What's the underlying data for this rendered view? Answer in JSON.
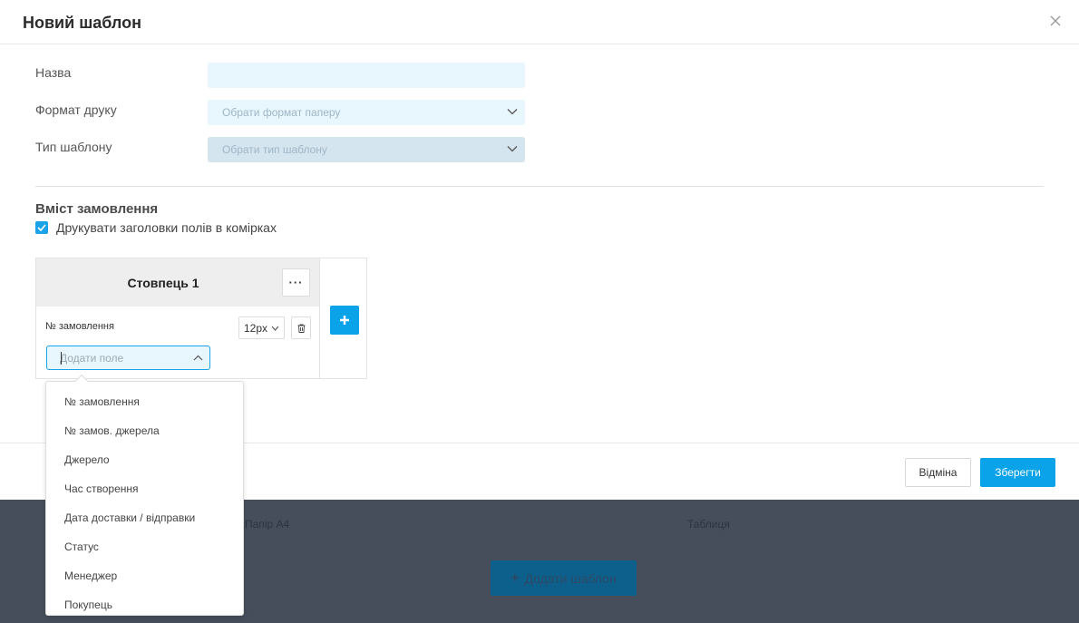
{
  "modal": {
    "title": "Новий шаблон",
    "close_icon": "close-icon"
  },
  "form": {
    "name_label": "Назва",
    "name_value": "",
    "print_format_label": "Формат друку",
    "print_format_placeholder": "Обрати формат паперу",
    "template_type_label": "Тип шаблону",
    "template_type_placeholder": "Обрати тип шаблону"
  },
  "order_content": {
    "section_title": "Вміст замовлення",
    "print_headers_checked": true,
    "print_headers_label": "Друкувати заголовки полів в комірках",
    "column": {
      "title": "Стовпець 1",
      "more_label": "···",
      "field_name": "№ замовлення",
      "font_size": "12px",
      "add_field_placeholder": "Додати поле"
    }
  },
  "dropdown": {
    "options": [
      "№ замовлення",
      "№ замов. джерела",
      "Джерело",
      "Час створення",
      "Дата доставки / відправки",
      "Статус",
      "Менеджер",
      "Покупець"
    ]
  },
  "footer": {
    "cancel_label": "Відміна",
    "save_label": "Зберегти"
  },
  "background": {
    "paper_label": "Папір А4",
    "table_label": "Таблиця",
    "add_template_label": "Додати шаблон"
  },
  "colors": {
    "accent": "#0aa2e9",
    "input_bg": "#e8f6fd",
    "backdrop": "#464e5c"
  }
}
